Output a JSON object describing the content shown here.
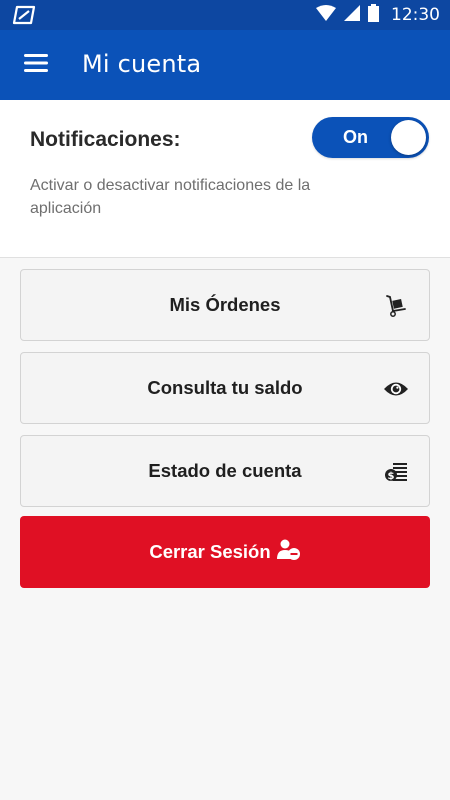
{
  "status_bar": {
    "time": "12:30",
    "icons": [
      "app-logo-icon",
      "wifi-icon",
      "signal-icon",
      "battery-icon"
    ]
  },
  "app_bar": {
    "title": "Mi cuenta",
    "menu_icon": "hamburger-menu-icon"
  },
  "notifications": {
    "title": "Notificaciones:",
    "description": "Activar o desactivar notificaciones de la aplicación",
    "toggle_label": "On",
    "enabled": true
  },
  "menu": {
    "items": [
      {
        "label": "Mis Órdenes",
        "icon": "hand-truck-icon"
      },
      {
        "label": "Consulta tu saldo",
        "icon": "eye-icon"
      },
      {
        "label": "Estado de cuenta",
        "icon": "money-statement-icon"
      }
    ]
  },
  "logout": {
    "label": "Cerrar Sesión",
    "icon": "user-remove-icon"
  },
  "colors": {
    "status_bar": "#0d47a1",
    "app_bar": "#0b52b8",
    "logout": "#e01024",
    "background": "#f7f7f7"
  }
}
